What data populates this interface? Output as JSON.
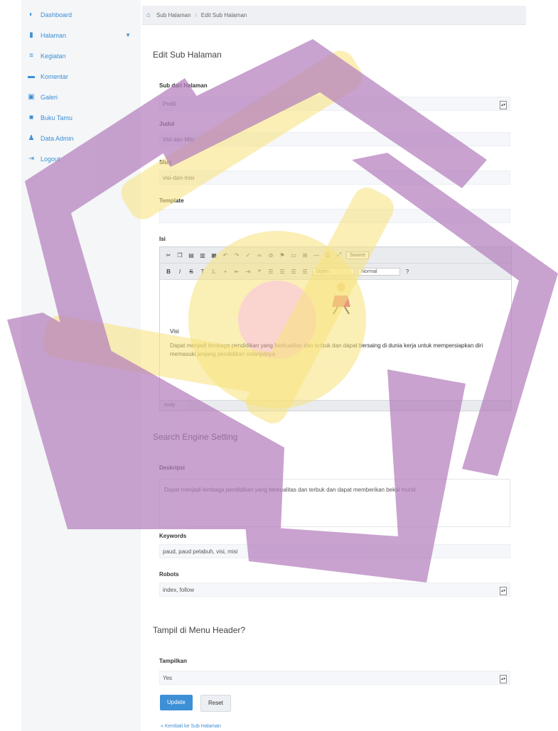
{
  "sidebar": {
    "items": [
      {
        "label": "Dashboard",
        "icon": "dashboard-icon"
      },
      {
        "label": "Halaman",
        "icon": "file-icon"
      },
      {
        "label": "Kegiatan",
        "icon": "list-icon"
      },
      {
        "label": "Komentar",
        "icon": "comment-icon"
      },
      {
        "label": "Galeri",
        "icon": "image-icon"
      },
      {
        "label": "Buku Tamu",
        "icon": "book-icon"
      },
      {
        "label": "Data Admin",
        "icon": "user-icon"
      },
      {
        "label": "Logout",
        "icon": "logout-icon"
      }
    ]
  },
  "breadcrumb": {
    "parent": "Sub Halaman",
    "current": "Edit Sub Halaman"
  },
  "form": {
    "title": "Edit Sub Halaman",
    "sub_dari_halaman": {
      "label": "Sub dari Halaman",
      "value": "Profil"
    },
    "judul": {
      "label": "Judul",
      "value": "Visi dan Misi"
    },
    "slug": {
      "label": "Slug",
      "value": "visi-dan-misi"
    },
    "template": {
      "label": "Template",
      "value": ""
    },
    "isi": {
      "label": "Isi"
    }
  },
  "editor": {
    "source_label": "Source",
    "styles_label": "Styles",
    "format_label": "Normal",
    "help_label": "?",
    "content_heading": "Visi",
    "content_text": "Dapat menjadi lembaga pendidikan yang berkualitas dan terbuk dan dapat bersaing di dunia kerja untuk mempersiapkan diri memasuki jenjang pendidikan selanjutnya",
    "status": "body"
  },
  "seo": {
    "title": "Search Engine Setting",
    "deskripsi_label": "Deskripsi",
    "deskripsi_value": "Dapat menjadi lembaga pendidikan yang berkualitas dan terbuk dan dapat memberikan bekal murid",
    "keywords_label": "Keywords",
    "keywords_value": "paud, paud pelabuh, visi, misi",
    "robots_label": "Robots",
    "robots_value": "index, follow"
  },
  "header_menu": {
    "title": "Tampil di Menu Header?",
    "tampilkan_label": "Tampilkan",
    "tampilkan_value": "Yes"
  },
  "buttons": {
    "update": "Update",
    "reset": "Reset"
  },
  "back_link": "« Kembali ke Sub Halaman",
  "colors": {
    "accent": "#3d8fd6",
    "overlay_purple": "#b47fbd",
    "overlay_yellow": "#f7e27a"
  }
}
